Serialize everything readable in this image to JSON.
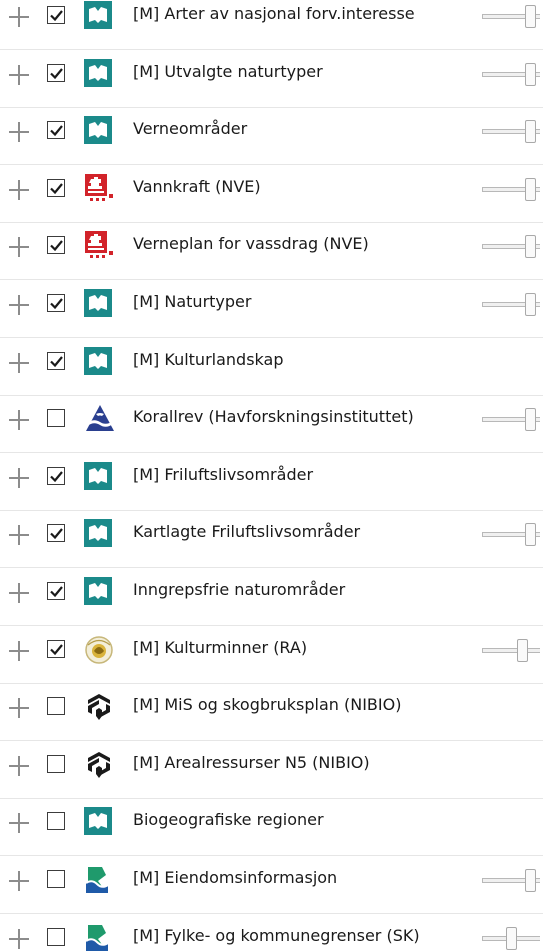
{
  "layers": [
    {
      "label": "[M] Arter av nasjonal forv.interesse",
      "checked": true,
      "icon": "miljodirektoratet-icon",
      "opacity": 0.92
    },
    {
      "label": "[M] Utvalgte naturtyper",
      "checked": true,
      "icon": "miljodirektoratet-icon",
      "opacity": 0.92
    },
    {
      "label": "Verneområder",
      "checked": true,
      "icon": "miljodirektoratet-icon",
      "opacity": 0.92
    },
    {
      "label": "Vannkraft (NVE)",
      "checked": true,
      "icon": "nve-icon",
      "opacity": 0.92
    },
    {
      "label": "Verneplan for vassdrag (NVE)",
      "checked": true,
      "icon": "nve-icon",
      "opacity": 0.92
    },
    {
      "label": "[M] Naturtyper",
      "checked": true,
      "icon": "miljodirektoratet-icon",
      "opacity": 0.92
    },
    {
      "label": "[M] Kulturlandskap",
      "checked": true,
      "icon": "miljodirektoratet-icon",
      "opacity": null
    },
    {
      "label": "Korallrev (Havforskningsinstituttet)",
      "checked": false,
      "icon": "havforskningsinstituttet-icon",
      "opacity": 0.92
    },
    {
      "label": "[M] Friluftslivsområder",
      "checked": true,
      "icon": "miljodirektoratet-icon",
      "opacity": null
    },
    {
      "label": "Kartlagte Friluftslivsområder",
      "checked": true,
      "icon": "miljodirektoratet-icon",
      "opacity": 0.92
    },
    {
      "label": "Inngrepsfrie naturområder",
      "checked": true,
      "icon": "miljodirektoratet-icon",
      "opacity": null
    },
    {
      "label": "[M] Kulturminner (RA)",
      "checked": true,
      "icon": "riksantikvaren-icon",
      "opacity": 0.75
    },
    {
      "label": "[M] MiS og skogbruksplan (NIBIO)",
      "checked": false,
      "icon": "nibio-icon",
      "opacity": null
    },
    {
      "label": "[M] Arealressurser N5 (NIBIO)",
      "checked": false,
      "icon": "nibio-icon",
      "opacity": null
    },
    {
      "label": "Biogeografiske regioner",
      "checked": false,
      "icon": "miljodirektoratet-icon",
      "opacity": null
    },
    {
      "label": "[M] Eiendomsinformasjon",
      "checked": false,
      "icon": "kartverket-icon",
      "opacity": 0.92
    },
    {
      "label": "[M] Fylke- og kommunegrenser (SK)",
      "checked": false,
      "icon": "kartverket-icon",
      "opacity": 0.5
    }
  ],
  "colors": {
    "miljodirektoratet": "#1b8a8a",
    "nve_red": "#d2232a",
    "havforsk_blue": "#2a3f8f",
    "kartverket_green": "#1f9a6c",
    "kartverket_blue": "#1f5aa8"
  }
}
